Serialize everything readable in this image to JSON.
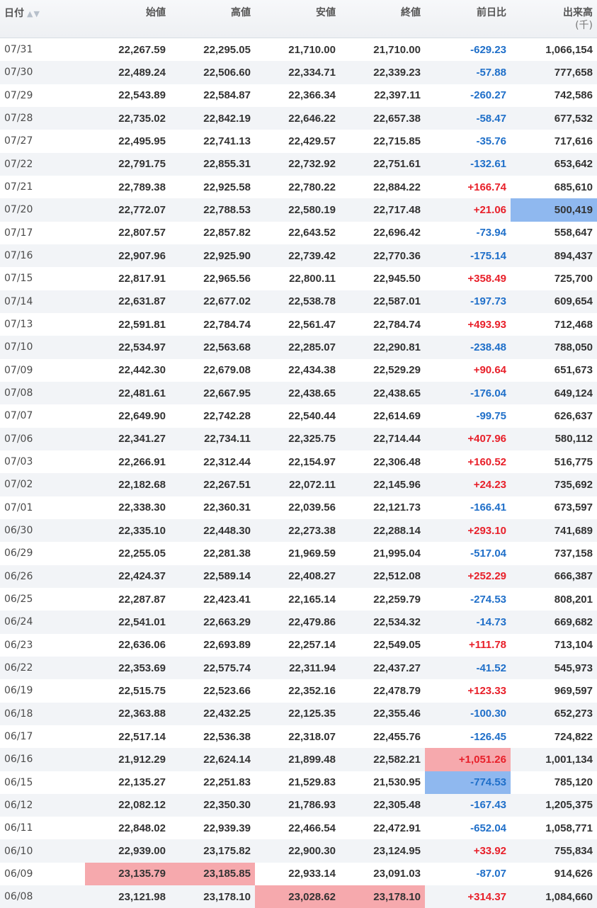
{
  "columns": {
    "date": "日付",
    "open": "始値",
    "high": "高値",
    "low": "安値",
    "close": "終値",
    "change": "前日比",
    "volume": "出来高",
    "volume_unit": "(千)"
  },
  "colors": {
    "positive": "#e8202a",
    "negative": "#1f6fc9",
    "highlight_red": "#f6a9ad",
    "highlight_blue": "#8fb8ef"
  },
  "rows": [
    {
      "date": "07/31",
      "open": "22,267.59",
      "high": "22,295.05",
      "low": "21,710.00",
      "close": "21,710.00",
      "change": "-629.23",
      "volume": "1,066,154",
      "hl": {}
    },
    {
      "date": "07/30",
      "open": "22,489.24",
      "high": "22,506.60",
      "low": "22,334.71",
      "close": "22,339.23",
      "change": "-57.88",
      "volume": "777,658",
      "hl": {}
    },
    {
      "date": "07/29",
      "open": "22,543.89",
      "high": "22,584.87",
      "low": "22,366.34",
      "close": "22,397.11",
      "change": "-260.27",
      "volume": "742,586",
      "hl": {}
    },
    {
      "date": "07/28",
      "open": "22,735.02",
      "high": "22,842.19",
      "low": "22,646.22",
      "close": "22,657.38",
      "change": "-58.47",
      "volume": "677,532",
      "hl": {}
    },
    {
      "date": "07/27",
      "open": "22,495.95",
      "high": "22,741.13",
      "low": "22,429.57",
      "close": "22,715.85",
      "change": "-35.76",
      "volume": "717,616",
      "hl": {}
    },
    {
      "date": "07/22",
      "open": "22,791.75",
      "high": "22,855.31",
      "low": "22,732.92",
      "close": "22,751.61",
      "change": "-132.61",
      "volume": "653,642",
      "hl": {}
    },
    {
      "date": "07/21",
      "open": "22,789.38",
      "high": "22,925.58",
      "low": "22,780.22",
      "close": "22,884.22",
      "change": "+166.74",
      "volume": "685,610",
      "hl": {}
    },
    {
      "date": "07/20",
      "open": "22,772.07",
      "high": "22,788.53",
      "low": "22,580.19",
      "close": "22,717.48",
      "change": "+21.06",
      "volume": "500,419",
      "hl": {
        "volume": "blue"
      }
    },
    {
      "date": "07/17",
      "open": "22,807.57",
      "high": "22,857.82",
      "low": "22,643.52",
      "close": "22,696.42",
      "change": "-73.94",
      "volume": "558,647",
      "hl": {}
    },
    {
      "date": "07/16",
      "open": "22,907.96",
      "high": "22,925.90",
      "low": "22,739.42",
      "close": "22,770.36",
      "change": "-175.14",
      "volume": "894,437",
      "hl": {}
    },
    {
      "date": "07/15",
      "open": "22,817.91",
      "high": "22,965.56",
      "low": "22,800.11",
      "close": "22,945.50",
      "change": "+358.49",
      "volume": "725,700",
      "hl": {}
    },
    {
      "date": "07/14",
      "open": "22,631.87",
      "high": "22,677.02",
      "low": "22,538.78",
      "close": "22,587.01",
      "change": "-197.73",
      "volume": "609,654",
      "hl": {}
    },
    {
      "date": "07/13",
      "open": "22,591.81",
      "high": "22,784.74",
      "low": "22,561.47",
      "close": "22,784.74",
      "change": "+493.93",
      "volume": "712,468",
      "hl": {}
    },
    {
      "date": "07/10",
      "open": "22,534.97",
      "high": "22,563.68",
      "low": "22,285.07",
      "close": "22,290.81",
      "change": "-238.48",
      "volume": "788,050",
      "hl": {}
    },
    {
      "date": "07/09",
      "open": "22,442.30",
      "high": "22,679.08",
      "low": "22,434.38",
      "close": "22,529.29",
      "change": "+90.64",
      "volume": "651,673",
      "hl": {}
    },
    {
      "date": "07/08",
      "open": "22,481.61",
      "high": "22,667.95",
      "low": "22,438.65",
      "close": "22,438.65",
      "change": "-176.04",
      "volume": "649,124",
      "hl": {}
    },
    {
      "date": "07/07",
      "open": "22,649.90",
      "high": "22,742.28",
      "low": "22,540.44",
      "close": "22,614.69",
      "change": "-99.75",
      "volume": "626,637",
      "hl": {}
    },
    {
      "date": "07/06",
      "open": "22,341.27",
      "high": "22,734.11",
      "low": "22,325.75",
      "close": "22,714.44",
      "change": "+407.96",
      "volume": "580,112",
      "hl": {}
    },
    {
      "date": "07/03",
      "open": "22,266.91",
      "high": "22,312.44",
      "low": "22,154.97",
      "close": "22,306.48",
      "change": "+160.52",
      "volume": "516,775",
      "hl": {}
    },
    {
      "date": "07/02",
      "open": "22,182.68",
      "high": "22,267.51",
      "low": "22,072.11",
      "close": "22,145.96",
      "change": "+24.23",
      "volume": "735,692",
      "hl": {}
    },
    {
      "date": "07/01",
      "open": "22,338.30",
      "high": "22,360.31",
      "low": "22,039.56",
      "close": "22,121.73",
      "change": "-166.41",
      "volume": "673,597",
      "hl": {}
    },
    {
      "date": "06/30",
      "open": "22,335.10",
      "high": "22,448.30",
      "low": "22,273.38",
      "close": "22,288.14",
      "change": "+293.10",
      "volume": "741,689",
      "hl": {}
    },
    {
      "date": "06/29",
      "open": "22,255.05",
      "high": "22,281.38",
      "low": "21,969.59",
      "close": "21,995.04",
      "change": "-517.04",
      "volume": "737,158",
      "hl": {}
    },
    {
      "date": "06/26",
      "open": "22,424.37",
      "high": "22,589.14",
      "low": "22,408.27",
      "close": "22,512.08",
      "change": "+252.29",
      "volume": "666,387",
      "hl": {}
    },
    {
      "date": "06/25",
      "open": "22,287.87",
      "high": "22,423.41",
      "low": "22,165.14",
      "close": "22,259.79",
      "change": "-274.53",
      "volume": "808,201",
      "hl": {}
    },
    {
      "date": "06/24",
      "open": "22,541.01",
      "high": "22,663.29",
      "low": "22,479.86",
      "close": "22,534.32",
      "change": "-14.73",
      "volume": "669,682",
      "hl": {}
    },
    {
      "date": "06/23",
      "open": "22,636.06",
      "high": "22,693.89",
      "low": "22,257.14",
      "close": "22,549.05",
      "change": "+111.78",
      "volume": "713,104",
      "hl": {}
    },
    {
      "date": "06/22",
      "open": "22,353.69",
      "high": "22,575.74",
      "low": "22,311.94",
      "close": "22,437.27",
      "change": "-41.52",
      "volume": "545,973",
      "hl": {}
    },
    {
      "date": "06/19",
      "open": "22,515.75",
      "high": "22,523.66",
      "low": "22,352.16",
      "close": "22,478.79",
      "change": "+123.33",
      "volume": "969,597",
      "hl": {}
    },
    {
      "date": "06/18",
      "open": "22,363.88",
      "high": "22,432.25",
      "low": "22,125.35",
      "close": "22,355.46",
      "change": "-100.30",
      "volume": "652,273",
      "hl": {}
    },
    {
      "date": "06/17",
      "open": "22,517.14",
      "high": "22,536.38",
      "low": "22,318.07",
      "close": "22,455.76",
      "change": "-126.45",
      "volume": "724,822",
      "hl": {}
    },
    {
      "date": "06/16",
      "open": "21,912.29",
      "high": "22,624.14",
      "low": "21,899.48",
      "close": "22,582.21",
      "change": "+1,051.26",
      "volume": "1,001,134",
      "hl": {
        "change": "red"
      }
    },
    {
      "date": "06/15",
      "open": "22,135.27",
      "high": "22,251.83",
      "low": "21,529.83",
      "close": "21,530.95",
      "change": "-774.53",
      "volume": "785,120",
      "hl": {
        "change": "blue"
      }
    },
    {
      "date": "06/12",
      "open": "22,082.12",
      "high": "22,350.30",
      "low": "21,786.93",
      "close": "22,305.48",
      "change": "-167.43",
      "volume": "1,205,375",
      "hl": {}
    },
    {
      "date": "06/11",
      "open": "22,848.02",
      "high": "22,939.39",
      "low": "22,466.54",
      "close": "22,472.91",
      "change": "-652.04",
      "volume": "1,058,771",
      "hl": {}
    },
    {
      "date": "06/10",
      "open": "22,939.00",
      "high": "23,175.82",
      "low": "22,900.30",
      "close": "23,124.95",
      "change": "+33.92",
      "volume": "755,834",
      "hl": {}
    },
    {
      "date": "06/09",
      "open": "23,135.79",
      "high": "23,185.85",
      "low": "22,933.14",
      "close": "23,091.03",
      "change": "-87.07",
      "volume": "914,626",
      "hl": {
        "open": "red",
        "high": "red"
      }
    },
    {
      "date": "06/08",
      "open": "23,121.98",
      "high": "23,178.10",
      "low": "23,028.62",
      "close": "23,178.10",
      "change": "+314.37",
      "volume": "1,084,660",
      "hl": {
        "low": "red",
        "close": "red"
      }
    }
  ]
}
